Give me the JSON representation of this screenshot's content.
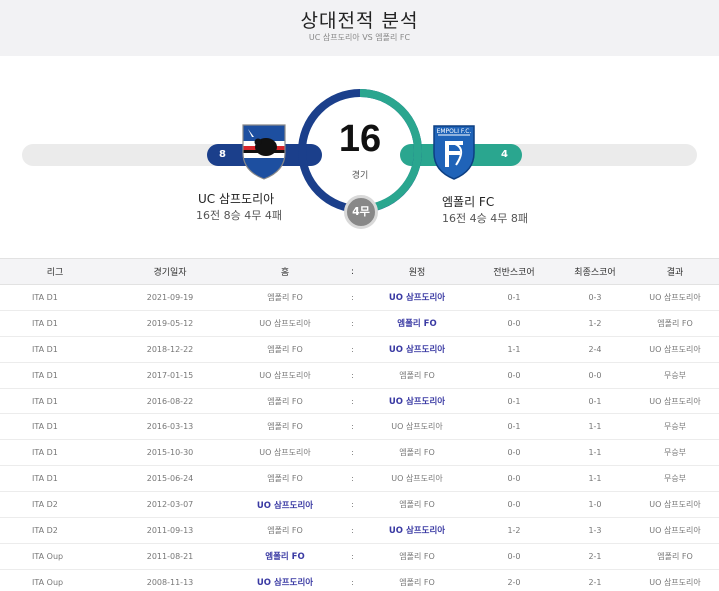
{
  "header": {
    "title": "상대전적 분석",
    "subtitle": "UC 삼프도리아 VS 엠폴리 FC"
  },
  "summary": {
    "total_games": "16",
    "total_label": "경기",
    "draws_badge": "4무",
    "home": {
      "name": "UC 삼프도리아",
      "record": "16전 8승 4무 4패",
      "wins": "8",
      "color": "#1b3f8b"
    },
    "away": {
      "name": "엠폴리 FC",
      "record": "16전 4승 4무 8패",
      "wins": "4",
      "color": "#2aa68f"
    }
  },
  "table": {
    "headers": {
      "league": "리그",
      "date": "경기일자",
      "home": "홈",
      "sep": ":",
      "away": "원정",
      "half_score": "전반스코어",
      "final_score": "최종스코어",
      "result": "결과"
    },
    "rows": [
      {
        "league": "ITA D1",
        "date": "2021-09-19",
        "home": "엠폴리 FO",
        "sep": ":",
        "away": "UO 삼프도리아",
        "half": "0-1",
        "final": "0-3",
        "result": "UO 삼프도리아"
      },
      {
        "league": "ITA D1",
        "date": "2019-05-12",
        "home": "UO 삼프도리아",
        "sep": ":",
        "away": "엠폴리 FO",
        "half": "0-0",
        "final": "1-2",
        "result": "엠폴리 FO"
      },
      {
        "league": "ITA D1",
        "date": "2018-12-22",
        "home": "엠폴리 FO",
        "sep": ":",
        "away": "UO 삼프도리아",
        "half": "1-1",
        "final": "2-4",
        "result": "UO 삼프도리아"
      },
      {
        "league": "ITA D1",
        "date": "2017-01-15",
        "home": "UO 삼프도리아",
        "sep": ":",
        "away": "엠폴리 FO",
        "half": "0-0",
        "final": "0-0",
        "result": "무승부"
      },
      {
        "league": "ITA D1",
        "date": "2016-08-22",
        "home": "엠폴리 FO",
        "sep": ":",
        "away": "UO 삼프도리아",
        "half": "0-1",
        "final": "0-1",
        "result": "UO 삼프도리아"
      },
      {
        "league": "ITA D1",
        "date": "2016-03-13",
        "home": "엠폴리 FO",
        "sep": ":",
        "away": "UO 삼프도리아",
        "half": "0-1",
        "final": "1-1",
        "result": "무승부"
      },
      {
        "league": "ITA D1",
        "date": "2015-10-30",
        "home": "UO 삼프도리아",
        "sep": ":",
        "away": "엠폴리 FO",
        "half": "0-0",
        "final": "1-1",
        "result": "무승부"
      },
      {
        "league": "ITA D1",
        "date": "2015-06-24",
        "home": "엠폴리 FO",
        "sep": ":",
        "away": "UO 삼프도리아",
        "half": "0-0",
        "final": "1-1",
        "result": "무승부"
      },
      {
        "league": "ITA D2",
        "date": "2012-03-07",
        "home": "UO 삼프도리아",
        "sep": ":",
        "away": "엠폴리 FO",
        "half": "0-0",
        "final": "1-0",
        "result": "UO 삼프도리아"
      },
      {
        "league": "ITA D2",
        "date": "2011-09-13",
        "home": "엠폴리 FO",
        "sep": ":",
        "away": "UO 삼프도리아",
        "half": "1-2",
        "final": "1-3",
        "result": "UO 삼프도리아"
      },
      {
        "league": "ITA Oup",
        "date": "2011-08-21",
        "home": "엠폴리 FO",
        "sep": ":",
        "away": "엠폴리 FO",
        "half": "0-0",
        "final": "2-1",
        "result": "엠폴리 FO"
      },
      {
        "league": "ITA Oup",
        "date": "2008-11-13",
        "home": "UO 삼프도리아",
        "sep": ":",
        "away": "엠폴리 FO",
        "half": "2-0",
        "final": "2-1",
        "result": "UO 삼프도리아"
      }
    ],
    "bold_cells": [
      [
        false,
        true
      ],
      [
        false,
        true
      ],
      [
        false,
        true
      ],
      [
        false,
        false
      ],
      [
        false,
        true
      ],
      [
        false,
        false
      ],
      [
        false,
        false
      ],
      [
        false,
        false
      ],
      [
        true,
        false
      ],
      [
        false,
        true
      ],
      [
        true,
        false
      ],
      [
        true,
        false
      ]
    ]
  }
}
